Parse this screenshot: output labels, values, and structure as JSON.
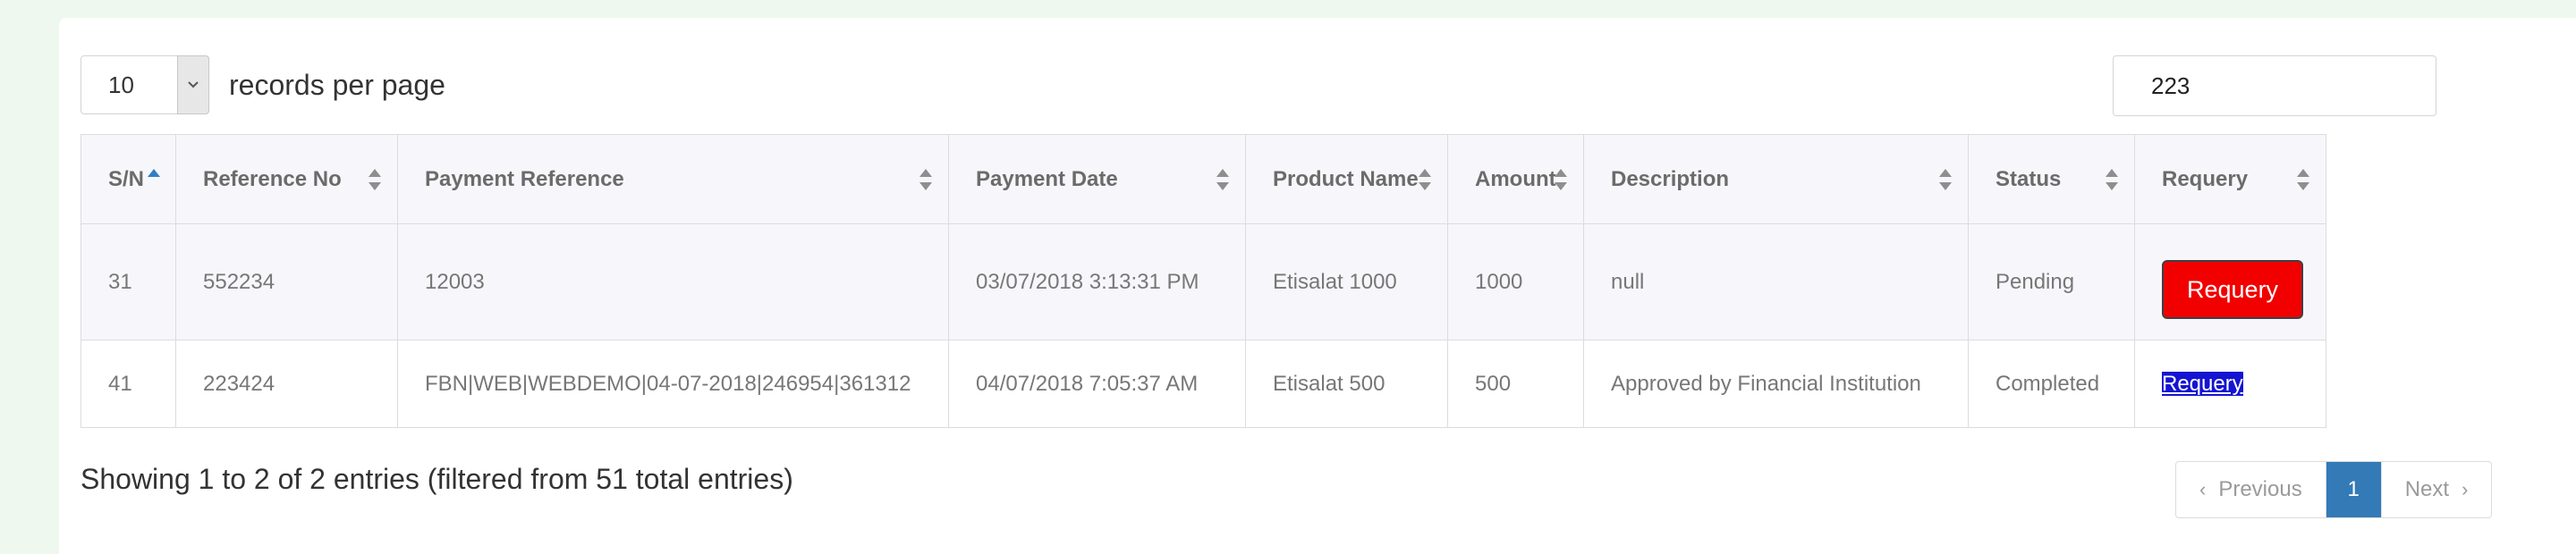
{
  "length_menu": {
    "value": "10",
    "label": "records per page"
  },
  "search": {
    "value": "223"
  },
  "table": {
    "headers": [
      "S/N",
      "Reference No",
      "Payment Reference",
      "Payment Date",
      "Product Name",
      "Amount",
      "Description",
      "Status",
      "Requery"
    ],
    "rows": [
      [
        "31",
        "552234",
        "12003",
        "03/07/2018 3:13:31 PM",
        "Etisalat 1000",
        "1000",
        "null",
        "Pending",
        "Requery"
      ],
      [
        "41",
        "223424",
        "FBN|WEB|WEBDEMO|04-07-2018|246954|361312",
        "04/07/2018 7:05:37 AM",
        "Etisalat 500",
        "500",
        "Approved by Financial Institution",
        "Completed",
        "Requery"
      ]
    ],
    "sorted_column": "S/N",
    "sort_direction": "ascending"
  },
  "footer": {
    "info": "Showing 1 to 2 of 2 entries (filtered from 51 total entries)"
  },
  "pagination": {
    "previous": "Previous",
    "current_page": "1",
    "next": "Next"
  },
  "colors": {
    "requery_button": "#f20000",
    "requery_link_highlight": "#1414d2",
    "active_page": "#337ab7",
    "page_background": "#eef8ee"
  },
  "icons": {
    "length_dropdown": "chevron-down-icon",
    "sort": "sort-icon",
    "previous": "chevron-left-icon",
    "next": "chevron-right-icon"
  }
}
